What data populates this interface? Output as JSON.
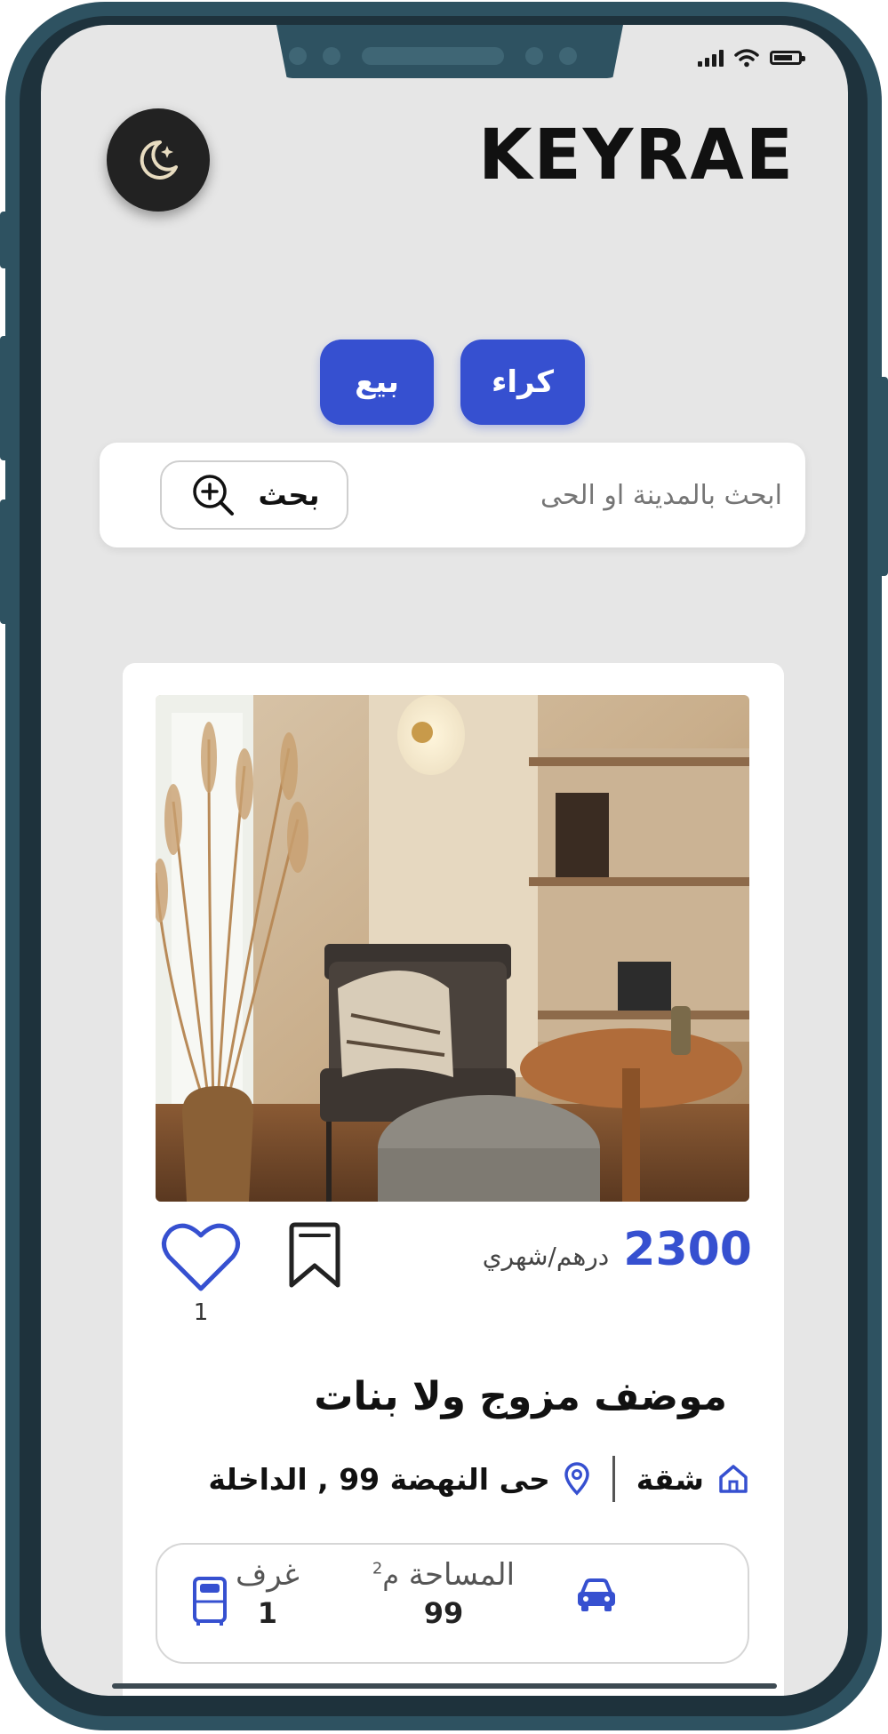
{
  "app": {
    "brand": "KEYRAE"
  },
  "status_bar": {
    "icons": [
      "signal-icon",
      "wifi-icon",
      "battery-icon"
    ]
  },
  "theme_toggle": {
    "icon": "moon-star-icon"
  },
  "tabs": [
    {
      "label": "كراء"
    },
    {
      "label": "بيع"
    }
  ],
  "search": {
    "placeholder": "ابحث بالمدينة او الحى",
    "button_label": "بحث",
    "button_icon": "zoom-search-icon"
  },
  "listing": {
    "image_alt": "living room with chair and pampas grass",
    "price": "2300",
    "period": "درهم/شهري",
    "likes": "1",
    "title": "موضف مزوج ولا بنات",
    "type": "شقة",
    "location": "حى النهضة 99 , الداخلة",
    "features": {
      "rooms_label": "غرف",
      "rooms_value": "1",
      "area_label": "المساحة",
      "area_unit": "م",
      "area_unit_sup": "2",
      "area_value": "99",
      "parking_icon": "car-icon"
    }
  },
  "colors": {
    "accent": "#3650d0",
    "frame": "#2e5261",
    "screen_bg": "#e6e6e6"
  }
}
